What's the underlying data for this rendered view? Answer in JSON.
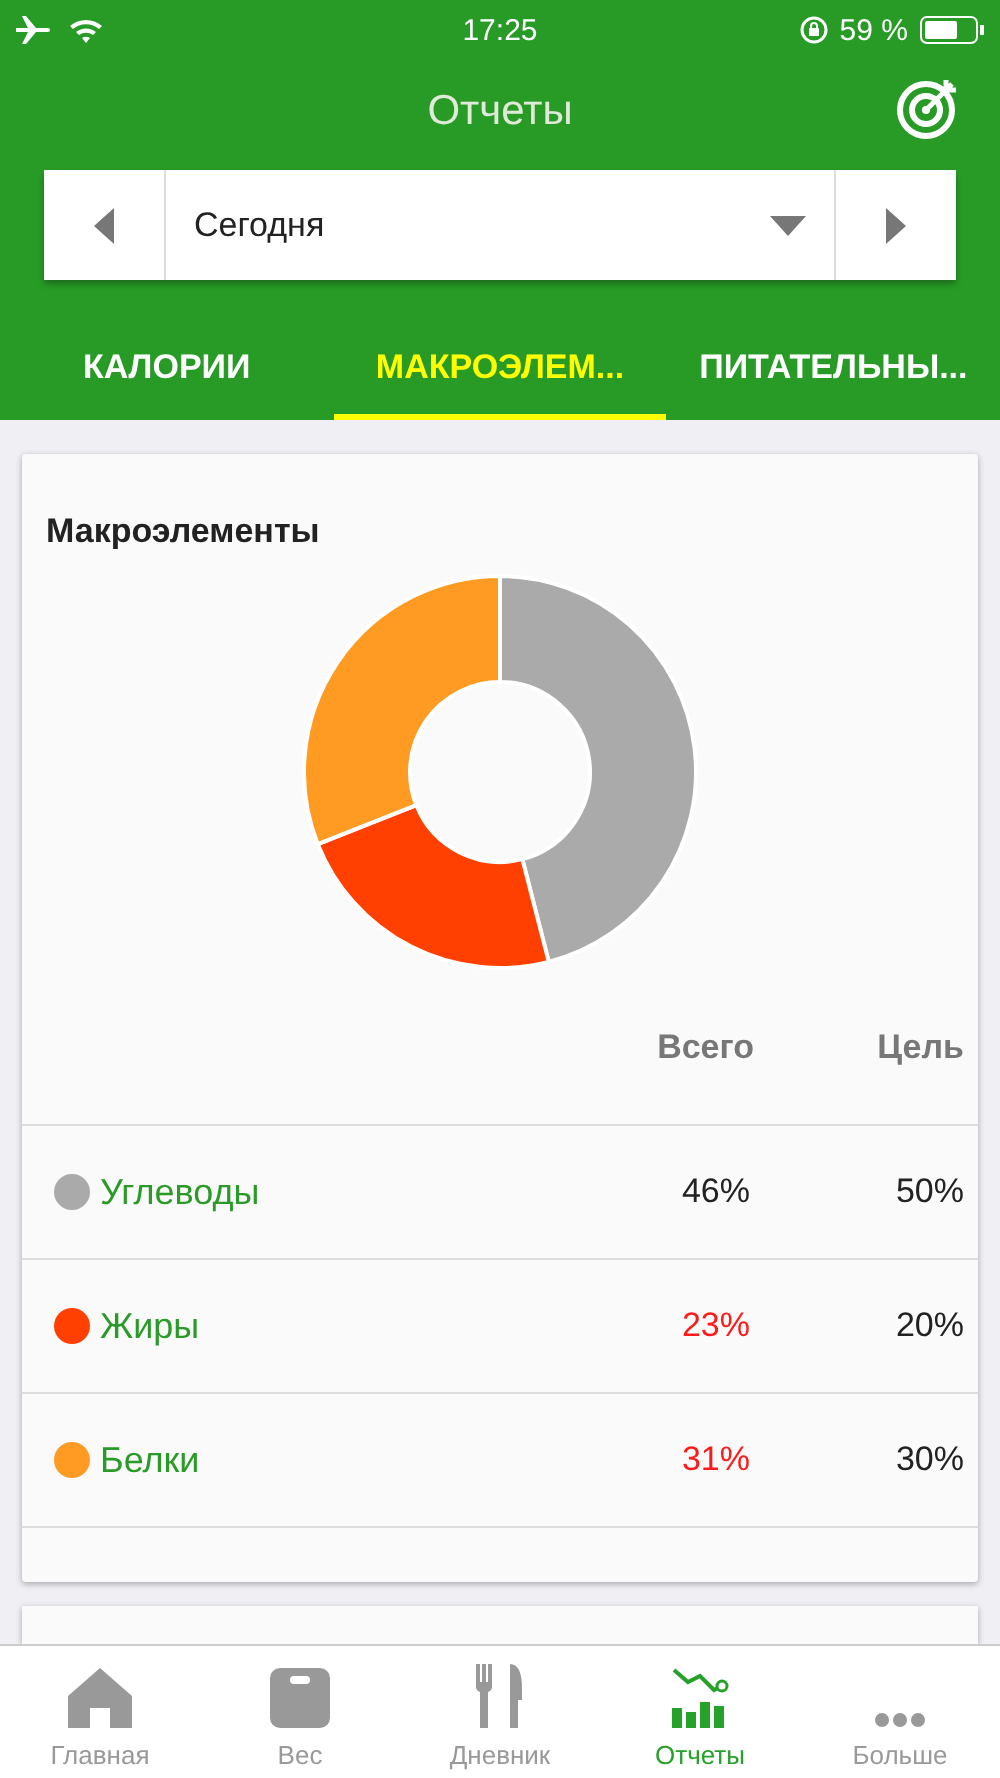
{
  "status_bar": {
    "time": "17:25",
    "battery": "59 %"
  },
  "header": {
    "title": "Отчеты"
  },
  "date_selector": {
    "value": "Сегодня"
  },
  "tabs": [
    {
      "label": "КАЛОРИИ",
      "selected": false
    },
    {
      "label": "МАКРОЭЛЕМ...",
      "selected": true
    },
    {
      "label": "ПИТАТЕЛЬНЫ...",
      "selected": false
    }
  ],
  "card": {
    "title": "Макроэлементы",
    "chart_data": {
      "type": "donut",
      "values": [
        46,
        23,
        31
      ]
    },
    "columns": [
      "Всего",
      "Цель"
    ],
    "rows": [
      {
        "name": "Углеводы",
        "color": "#aaaaaa",
        "total": "46%",
        "goal": "50%",
        "over": false
      },
      {
        "name": "Жиры",
        "color": "#ff4000",
        "total": "23%",
        "goal": "20%",
        "over": true
      },
      {
        "name": "Белки",
        "color": "#ff9b22",
        "total": "31%",
        "goal": "30%",
        "over": true
      }
    ]
  },
  "nav": [
    {
      "kind": "home",
      "label": "Главная",
      "selected": false
    },
    {
      "kind": "scale",
      "label": "Вес",
      "selected": false
    },
    {
      "kind": "diary",
      "label": "Дневник",
      "selected": false
    },
    {
      "kind": "reports",
      "label": "Отчеты",
      "selected": true
    },
    {
      "kind": "more",
      "label": "Больше",
      "selected": false
    }
  ]
}
